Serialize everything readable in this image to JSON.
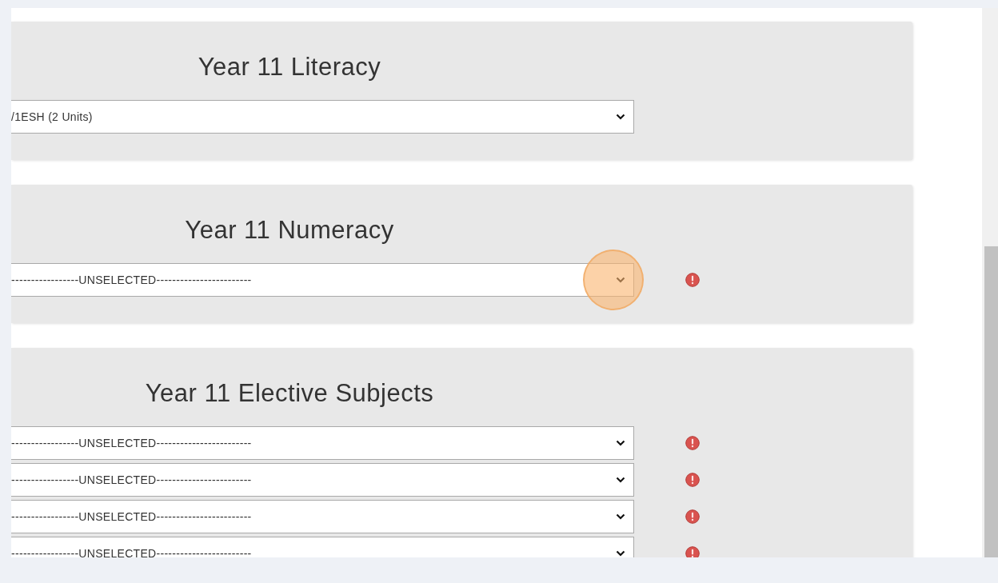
{
  "sections": [
    {
      "title": "Year 11 Literacy",
      "dropdowns": [
        {
          "value": "/1ESH (2 Units)",
          "error": false,
          "highlighted": false
        }
      ]
    },
    {
      "title": "Year 11 Numeracy",
      "dropdowns": [
        {
          "value": "-----------------UNSELECTED------------------------",
          "error": true,
          "highlighted": true
        }
      ]
    },
    {
      "title": "Year 11 Elective Subjects",
      "dropdowns": [
        {
          "value": "-----------------UNSELECTED------------------------",
          "error": true,
          "highlighted": false
        },
        {
          "value": "-----------------UNSELECTED------------------------",
          "error": true,
          "highlighted": false
        },
        {
          "value": "-----------------UNSELECTED------------------------",
          "error": true,
          "highlighted": false
        },
        {
          "value": "-----------------UNSELECTED------------------------",
          "error": true,
          "highlighted": false
        }
      ]
    }
  ]
}
